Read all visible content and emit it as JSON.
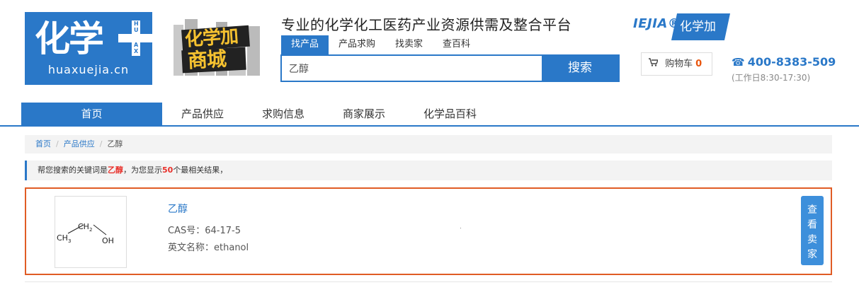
{
  "logo": {
    "big_text": "化学",
    "plus_letters": [
      "H",
      "U",
      "A",
      "X"
    ],
    "url": "huaxuejia.cn"
  },
  "mall": {
    "line1": "化学加",
    "line2": "商城"
  },
  "header": {
    "slogan": "专业的化学化工医药产业资源供需及整合平台",
    "search_tabs": [
      {
        "label": "找产品",
        "active": true
      },
      {
        "label": "产品求购",
        "active": false
      },
      {
        "label": "找卖家",
        "active": false
      },
      {
        "label": "查百科",
        "active": false
      }
    ],
    "search_value": "乙醇",
    "search_button": "搜索"
  },
  "brand": {
    "en": "IEJIA®",
    "cn": "化学加"
  },
  "cart": {
    "icon": "cart-icon",
    "label": "购物车",
    "count": "0"
  },
  "contact": {
    "icon": "phone-icon",
    "phone": "400-8383-509",
    "hours": "(工作日8:30-17:30)"
  },
  "nav": [
    {
      "label": "首页",
      "active": true
    },
    {
      "label": "产品供应",
      "active": false
    },
    {
      "label": "求购信息",
      "active": false
    },
    {
      "label": "商家展示",
      "active": false
    },
    {
      "label": "化学品百科",
      "active": false
    }
  ],
  "breadcrumb": [
    {
      "label": "首页",
      "link": true
    },
    {
      "label": "产品供应",
      "link": true
    },
    {
      "label": "乙醇",
      "link": false
    }
  ],
  "breadcrumb_sep": "/",
  "notice": {
    "prefix": "帮您搜索的关键词是",
    "keyword": "乙醇",
    "middle": "，为您显示",
    "count": "50",
    "suffix": "个最相关结果，"
  },
  "result": {
    "name": "乙醇",
    "cas_label": "CAS号：",
    "cas": "64-17-5",
    "en_label": "英文名称：",
    "en_name": "ethanol",
    "structure_labels": {
      "c1": "CH",
      "c1_sub": "2",
      "c2": "CH",
      "c2_sub": "3",
      "oh": "OH"
    },
    "view_button": "查看卖家",
    "view_chars": [
      "查",
      "看",
      "卖",
      "家"
    ]
  },
  "colors": {
    "primary": "#2a78c8",
    "accent": "#e05c25",
    "highlight": "#e8302a"
  }
}
